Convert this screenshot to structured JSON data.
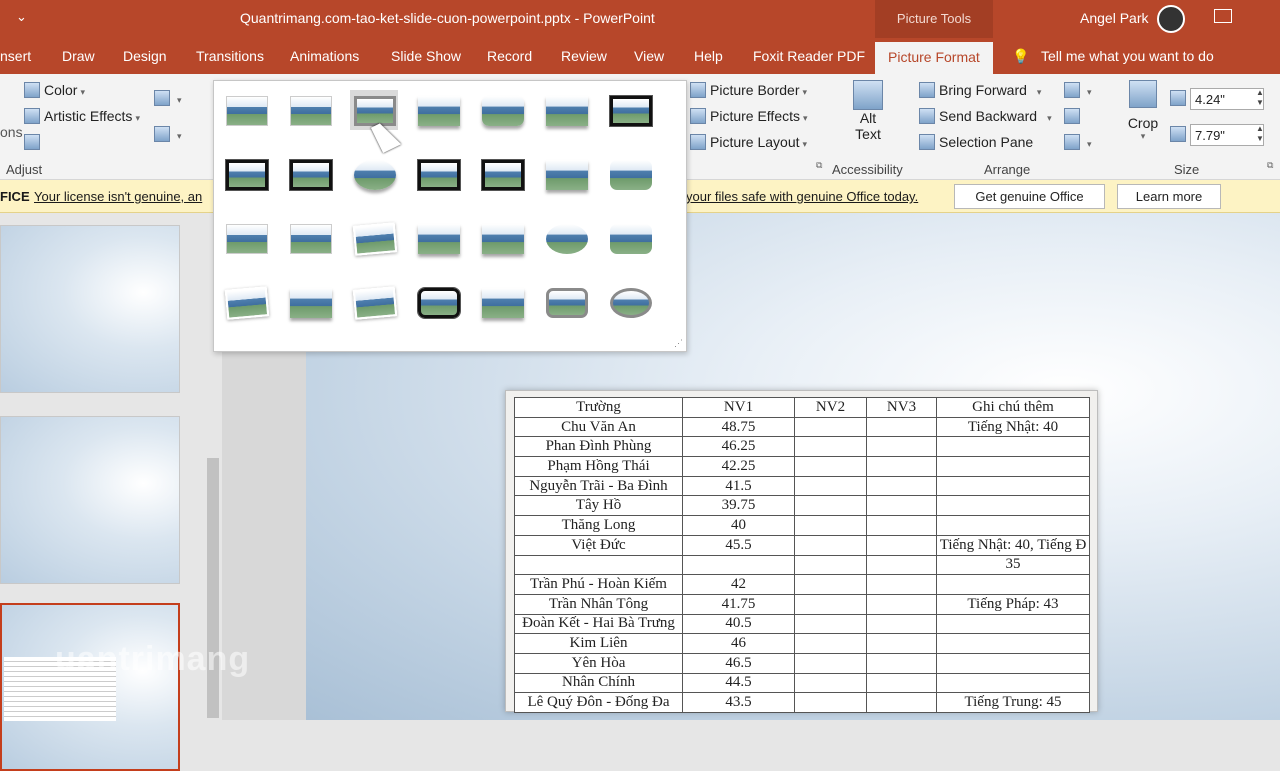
{
  "titlebar": {
    "doc": "Quantrimang.com-tao-ket-slide-cuon-powerpoint.pptx - PowerPoint",
    "context": "Picture Tools",
    "user": "Angel Park"
  },
  "tabs": [
    "nsert",
    "Draw",
    "Design",
    "Transitions",
    "Animations",
    "Slide Show",
    "Record",
    "Review",
    "View",
    "Help",
    "Foxit Reader PDF",
    "Picture Format",
    "Tell me what you want to do"
  ],
  "ribbon": {
    "adjust": {
      "color": "Color",
      "artistic": "Artistic Effects",
      "group": "Adjust",
      "left_cut": "ons"
    },
    "styles": {
      "border": "Picture Border",
      "effects": "Picture Effects",
      "layout": "Picture Layout"
    },
    "accessibility": {
      "alt1": "Alt",
      "alt2": "Text",
      "group": "Accessibility"
    },
    "arrange": {
      "forward": "Bring Forward",
      "backward": "Send Backward",
      "pane": "Selection Pane",
      "group": "Arrange"
    },
    "size": {
      "crop": "Crop",
      "height": "4.24\"",
      "width": "7.79\"",
      "group": "Size"
    }
  },
  "msgbar": {
    "prefix": "FICE",
    "text1": "Your license isn't genuine, an",
    "text2": "your files safe with genuine Office today.",
    "btn1": "Get genuine Office",
    "btn2": "Learn more"
  },
  "table": {
    "header": [
      "Trường",
      "NV1",
      "NV2",
      "NV3",
      "Ghi chú thêm"
    ],
    "rows": [
      [
        "Chu Văn An",
        "48.75",
        "",
        "",
        "Tiếng Nhật: 40"
      ],
      [
        "Phan Đình Phùng",
        "46.25",
        "",
        "",
        ""
      ],
      [
        "Phạm Hồng Thái",
        "42.25",
        "",
        "",
        ""
      ],
      [
        "Nguyễn Trãi - Ba Đình",
        "41.5",
        "",
        "",
        ""
      ],
      [
        "Tây Hồ",
        "39.75",
        "",
        "",
        ""
      ],
      [
        "Thăng Long",
        "40",
        "",
        "",
        ""
      ],
      [
        "Việt Đức",
        "45.5",
        "",
        "",
        "Tiếng Nhật: 40, Tiếng Đ"
      ],
      [
        "",
        "",
        "",
        "",
        "35"
      ],
      [
        "Trần Phú - Hoàn Kiếm",
        "42",
        "",
        "",
        ""
      ],
      [
        "Trần Nhân Tông",
        "41.75",
        "",
        "",
        "Tiếng Pháp: 43"
      ],
      [
        "Đoàn Kết - Hai Bà Trưng",
        "40.5",
        "",
        "",
        ""
      ],
      [
        "Kim Liên",
        "46",
        "",
        "",
        ""
      ],
      [
        "Yên Hòa",
        "46.5",
        "",
        "",
        ""
      ],
      [
        "Nhân Chính",
        "44.5",
        "",
        "",
        ""
      ],
      [
        "Lê Quý Đôn - Đống Đa",
        "43.5",
        "",
        "",
        "Tiếng Trung: 45"
      ]
    ]
  },
  "gallery": {
    "styles": [
      "Simple Frame, White",
      "Beveled Matte, White",
      "Metal Frame",
      "Drop Shadow Rectangle",
      "Reflected Rounded Rectangle",
      "Soft Edge Rectangle",
      "Double Frame, Black",
      "Thick Matte, Black",
      "Simple Frame, Black",
      "Beveled Oval, Black",
      "Compound Frame, Black",
      "Moderate Frame, Black",
      "Center Shadow Rectangle",
      "Rounded Diagonal Corner, White",
      "Snip Diagonal Corner, White",
      "Moderate Frame, White",
      "Rotated, White",
      "Perspective Shadow, White",
      "Relaxed Perspective, White",
      "Soft Edge Oval",
      "Bevel Rectangle",
      "Bevel Perspective",
      "Reflected Bevel, White",
      "Bevel Perspective Left, White",
      "Metal Rounded Rectangle",
      "Reflected Perspective Right",
      "Metal Oval",
      "Metal Oval Gray"
    ]
  },
  "watermark": "uantrimang"
}
